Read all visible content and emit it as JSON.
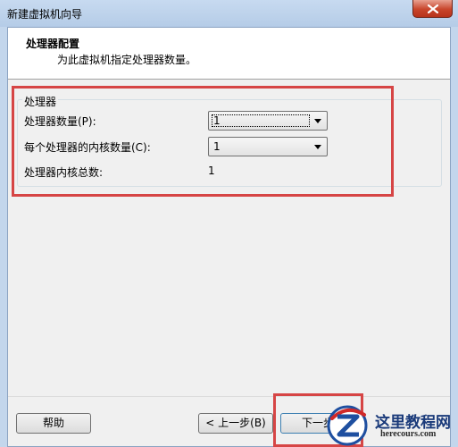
{
  "window": {
    "title": "新建虚拟机向导"
  },
  "header": {
    "title": "处理器配置",
    "subtitle": "为此虚拟机指定处理器数量。"
  },
  "processor_group": {
    "legend": "处理器",
    "cpu_count_label": "处理器数量(P):",
    "cpu_count_value": "1",
    "cores_label": "每个处理器的内核数量(C):",
    "cores_value": "1",
    "total_label": "处理器内核总数:",
    "total_value": "1"
  },
  "footer": {
    "help_label": "帮助",
    "back_label": "< 上一步(B)",
    "next_label": "下一步"
  },
  "watermark": {
    "brand": "这里教程网",
    "url": "herecours.com"
  },
  "colors": {
    "annotation": "#d64545",
    "titlebar": "#c7daf0",
    "close_button": "#c8452b"
  }
}
